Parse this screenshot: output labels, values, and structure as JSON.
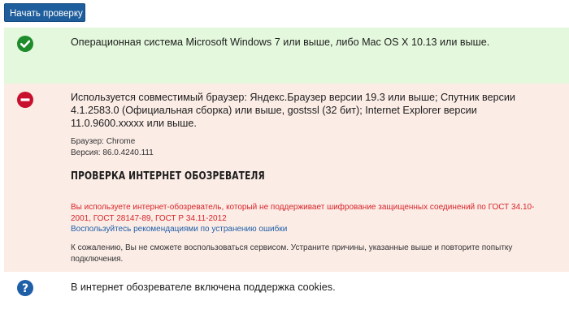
{
  "toolbar": {
    "start_button_label": "Начать проверку"
  },
  "checks": {
    "os": {
      "status": "ok",
      "status_color": "#1e8c2b",
      "icon": "check-circle-icon",
      "text": "Операционная система Microsoft Windows 7 или выше, либо Mac OS X 10.13 или выше."
    },
    "browser": {
      "status": "error",
      "status_color": "#c8102e",
      "icon": "minus-circle-icon",
      "text": "Используется совместимый браузер: Яндекс.Браузер версии 19.3 или выше; Спутник версии 4.1.2583.0 (Официальная сборка) или выше, gostssl (32 бит); Internet Explorer версии 11.0.9600.xxxxx или выше.",
      "browser_line": "Браузер: Chrome",
      "version_line": "Версия: 86.0.4240.111",
      "section_title": "ПРОВЕРКА ИНТЕРНЕТ ОБОЗРЕВАТЕЛЯ",
      "error_text": "Вы используете интернет-обозреватель, который не поддерживает шифрование защищенных соединений по ГОСТ 34.10-2001, ГОСТ 28147-89, ГОСТ Р 34.11-2012",
      "help_link": "Воспользуйтесь рекомендациями по устранению ошибки",
      "sorry_text": "К сожалению, Вы не сможете воспользоваться сервисом. Устраните причины, указанные выше и повторите попытку подключения."
    },
    "cookies": {
      "status": "unknown",
      "status_color": "#1f5fa8",
      "icon": "question-circle-icon",
      "text": "В интернет обозревателе включена поддержка cookies."
    }
  }
}
